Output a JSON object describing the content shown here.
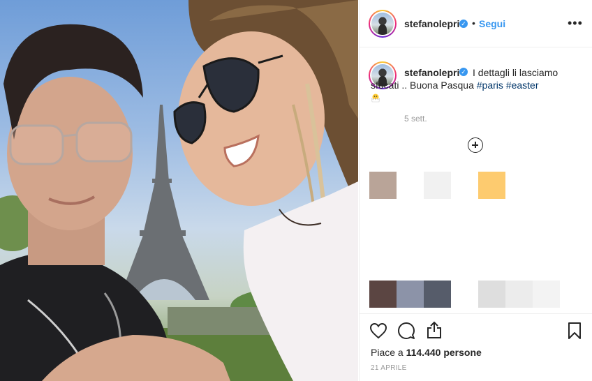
{
  "post": {
    "username": "stefanolepri",
    "verified_mark": "✓",
    "separator": "•",
    "follow_label": "Segui",
    "more_label": "•••",
    "caption_text": "I dettagli li lasciamo sfocati .. Buona Pasqua ",
    "hashtag_1": "#paris",
    "hashtag_2": "#easter",
    "emoji": "hatching-chick-emoji",
    "caption_time": "5 sett.",
    "likes_prefix": "Piace a ",
    "likes_count": "114.440",
    "likes_suffix": " persone",
    "date": "21 APRILE"
  },
  "icons": {
    "like": "heart-icon",
    "comment": "comment-icon",
    "share": "share-icon",
    "save": "bookmark-icon",
    "add": "plus-circle-icon",
    "more": "more-options-icon"
  },
  "colors": {
    "accent_blue": "#3897f0",
    "hashtag": "#003569",
    "muted": "#999999",
    "swatches_row1": [
      "#b9a498",
      "#f1f1f1",
      "#fdcb6f"
    ],
    "swatches_row2": [
      "#5b4542",
      "#8c93a8",
      "#565c6a",
      "#dedede",
      "#ececec",
      "#f3f3f3"
    ]
  }
}
